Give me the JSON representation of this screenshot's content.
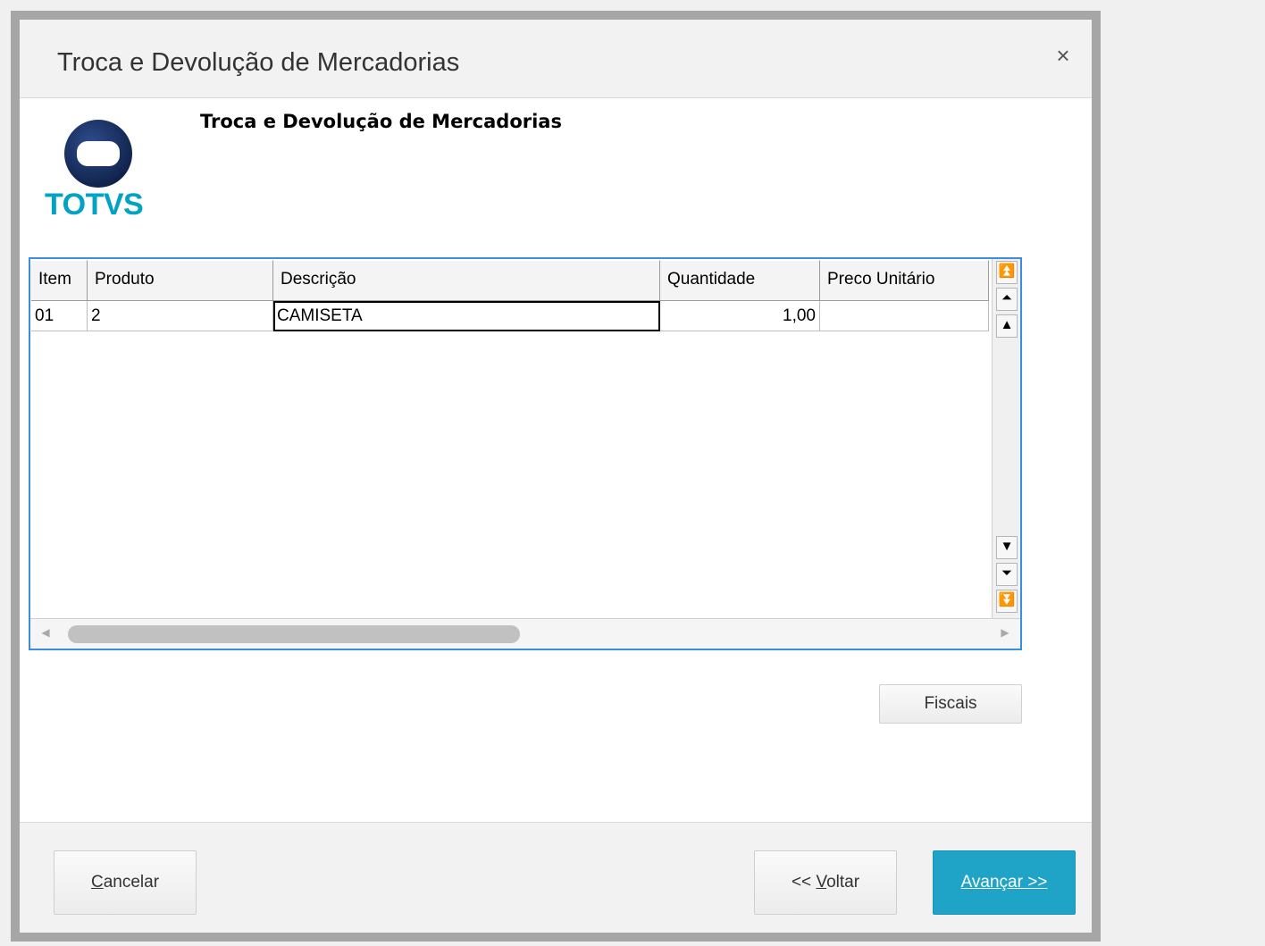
{
  "window": {
    "title": "Troca e Devolução de Mercadorias",
    "close_symbol": "×"
  },
  "logo": {
    "brand": "TOTVS",
    "color": "#00a3c4"
  },
  "header": {
    "title": "Troca e Devolução de Mercadorias"
  },
  "grid": {
    "columns": [
      "Item",
      "Produto",
      "Descrição",
      "Quantidade",
      "Preco Unitário"
    ],
    "rows": [
      {
        "item": "01",
        "produto": "2",
        "descricao": "CAMISETA",
        "quantidade": "1,00",
        "preco_unitario": ""
      }
    ],
    "scroll_icons": {
      "first": "⏫",
      "page_up": "⏶",
      "up": "▲",
      "down": "▼",
      "page_down": "⏷",
      "last": "⏬"
    }
  },
  "buttons": {
    "fiscais": "Fiscais",
    "cancelar_first": "C",
    "cancelar_rest": "ancelar",
    "voltar_prefix": "<< ",
    "voltar_first": "V",
    "voltar_rest": "oltar",
    "avancar_label": "Avançar >>",
    "accent_color": "#1fa3c7"
  }
}
